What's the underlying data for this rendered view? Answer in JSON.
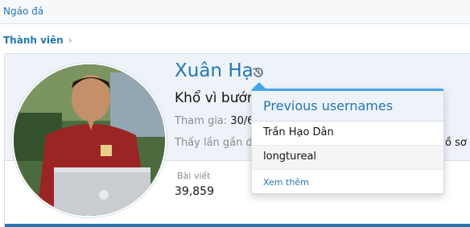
{
  "topbar": {
    "link": "Ngáo đá"
  },
  "breadcrumb": {
    "label": "Thành viên",
    "chevron": "›"
  },
  "profile": {
    "name": "Xuân Hạ",
    "title": "Khổ vì bướm",
    "joined_label": "Tham gia:",
    "joined_value": "30/6",
    "last_seen": "Thấy lần gần đ",
    "tail_text": "ồ sơ",
    "stats": {
      "posts_label": "Bài viết",
      "posts_value": "39,859"
    }
  },
  "popup": {
    "title": "Previous usernames",
    "items": [
      "Trần Hạo Dân",
      "longtureal"
    ],
    "more": "Xem thêm"
  },
  "icons": {
    "history": "history-icon",
    "avatar": "avatar"
  },
  "colors": {
    "accent": "#2577b1",
    "accent_light": "#47a7eb",
    "header_bg": "#edf3f9"
  }
}
